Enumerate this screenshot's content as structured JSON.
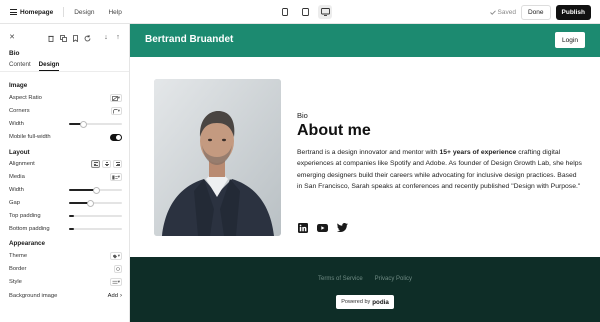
{
  "topbar": {
    "home_label": "Homepage",
    "links": [
      "Design",
      "Help"
    ],
    "saved_label": "Saved",
    "done_label": "Done",
    "publish_label": "Publish"
  },
  "sidebar": {
    "section_title": "Bio",
    "tabs": [
      "Content",
      "Design"
    ],
    "image": {
      "heading": "Image",
      "aspect_ratio_label": "Aspect Ratio",
      "corners_label": "Corners",
      "width_label": "Width",
      "width_value": 0.1,
      "mobile_full_width_label": "Mobile full-width",
      "mobile_full_width_on": true
    },
    "layout": {
      "heading": "Layout",
      "alignment_label": "Alignment",
      "media_label": "Media",
      "width_label": "Width",
      "width_value": 0.5,
      "gap_label": "Gap",
      "gap_value": 0.4,
      "top_padding_label": "Top padding",
      "top_padding_value": 0.08,
      "bottom_padding_label": "Bottom padding",
      "bottom_padding_value": 0.08
    },
    "appearance": {
      "heading": "Appearance",
      "theme_label": "Theme",
      "border_label": "Border",
      "style_label": "Style",
      "background_image_label": "Background image",
      "background_image_action": "Add"
    }
  },
  "site": {
    "name": "Bertrand Bruandet",
    "login_label": "Login",
    "header_color": "#1c8a70",
    "footer_color": "#0e2d27",
    "bio": {
      "eyebrow": "Bio",
      "heading": "About me",
      "body_before": "Bertrand is a design innovator and mentor with ",
      "body_bold": "15+ years of experience",
      "body_after": " crafting digital experiences at companies like Spotify and Adobe. As founder of Design Growth Lab, she helps emerging designers build their careers while advocating for inclusive design practices. Based in San Francisco, Sarah speaks at conferences and recently published \"Design with Purpose.\""
    },
    "socials": [
      "linkedin-icon",
      "youtube-icon",
      "twitter-icon"
    ],
    "footer": {
      "links": [
        "Terms of Service",
        "Privacy Policy"
      ],
      "powered_prefix": "Powered by",
      "powered_brand": "podia"
    }
  }
}
